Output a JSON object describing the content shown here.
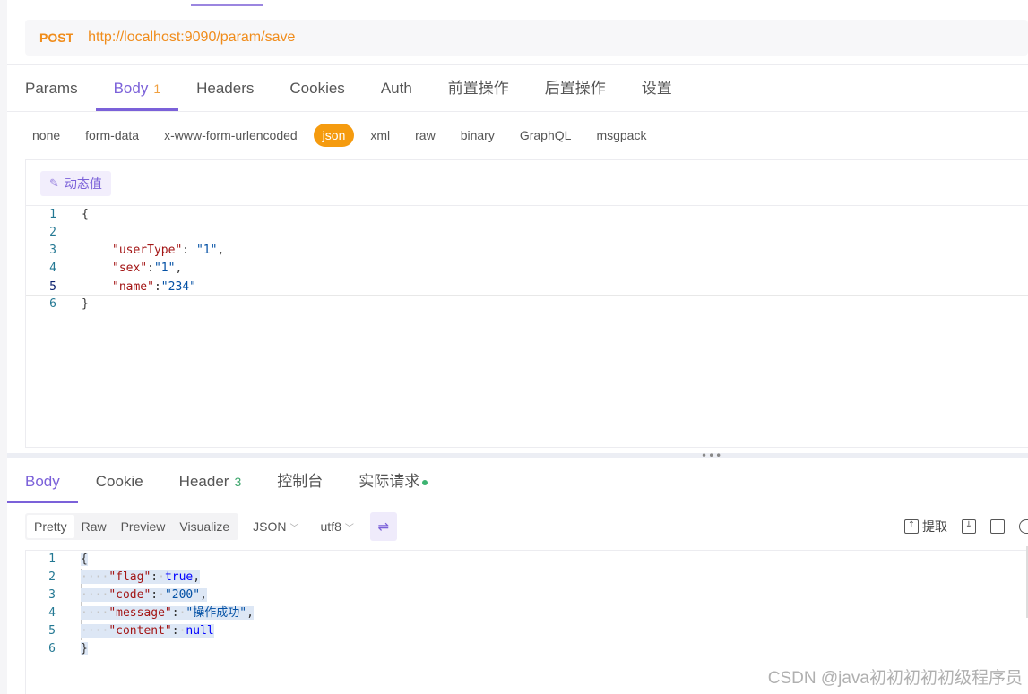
{
  "request": {
    "method": "POST",
    "url": "http://localhost:9090/param/save"
  },
  "request_tabs": [
    {
      "label": "Params"
    },
    {
      "label": "Body",
      "badge": "1"
    },
    {
      "label": "Headers"
    },
    {
      "label": "Cookies"
    },
    {
      "label": "Auth"
    },
    {
      "label": "前置操作"
    },
    {
      "label": "后置操作"
    },
    {
      "label": "设置"
    }
  ],
  "body_types": [
    "none",
    "form-data",
    "x-www-form-urlencoded",
    "json",
    "xml",
    "raw",
    "binary",
    "GraphQL",
    "msgpack"
  ],
  "body_types_active": "json",
  "dynamic_value_label": "动态值",
  "request_body_lines": [
    {
      "n": "1",
      "text": "{"
    },
    {
      "n": "2",
      "text": ""
    },
    {
      "n": "3",
      "text": "\"userType\": \"1\","
    },
    {
      "n": "4",
      "text": "\"sex\":\"1\","
    },
    {
      "n": "5",
      "text": "\"name\":\"234\""
    },
    {
      "n": "6",
      "text": "}"
    }
  ],
  "request_body_tokens": {
    "l3_key": "\"userType\"",
    "l3_sep": ": ",
    "l3_val": "\"1\"",
    "l3_end": ",",
    "l4_key": "\"sex\"",
    "l4_sep": ":",
    "l4_val": "\"1\"",
    "l4_end": ",",
    "l5_key": "\"name\"",
    "l5_sep": ":",
    "l5_val": "\"234\""
  },
  "response_tabs": [
    {
      "label": "Body"
    },
    {
      "label": "Cookie"
    },
    {
      "label": "Header",
      "badge": "3"
    },
    {
      "label": "控制台"
    },
    {
      "label": "实际请求"
    }
  ],
  "response_formats": [
    "Pretty",
    "Raw",
    "Preview",
    "Visualize"
  ],
  "response_format_active": "Pretty",
  "response_type_select": "JSON",
  "response_encoding_select": "utf8",
  "extract_label": "提取",
  "response_lines": {
    "n": [
      "1",
      "2",
      "3",
      "4",
      "5",
      "6"
    ],
    "open": "{",
    "close": "}",
    "flag_key": "\"flag\"",
    "flag_val": "true",
    "code_key": "\"code\"",
    "code_val": "\"200\"",
    "message_key": "\"message\"",
    "message_val": "\"操作成功\"",
    "content_key": "\"content\"",
    "content_val": "null"
  },
  "watermark": "CSDN @java初初初初初级程序员",
  "colors": {
    "accent": "#7b61d9",
    "method": "#f08c1b",
    "active_type": "#f59b0f"
  }
}
